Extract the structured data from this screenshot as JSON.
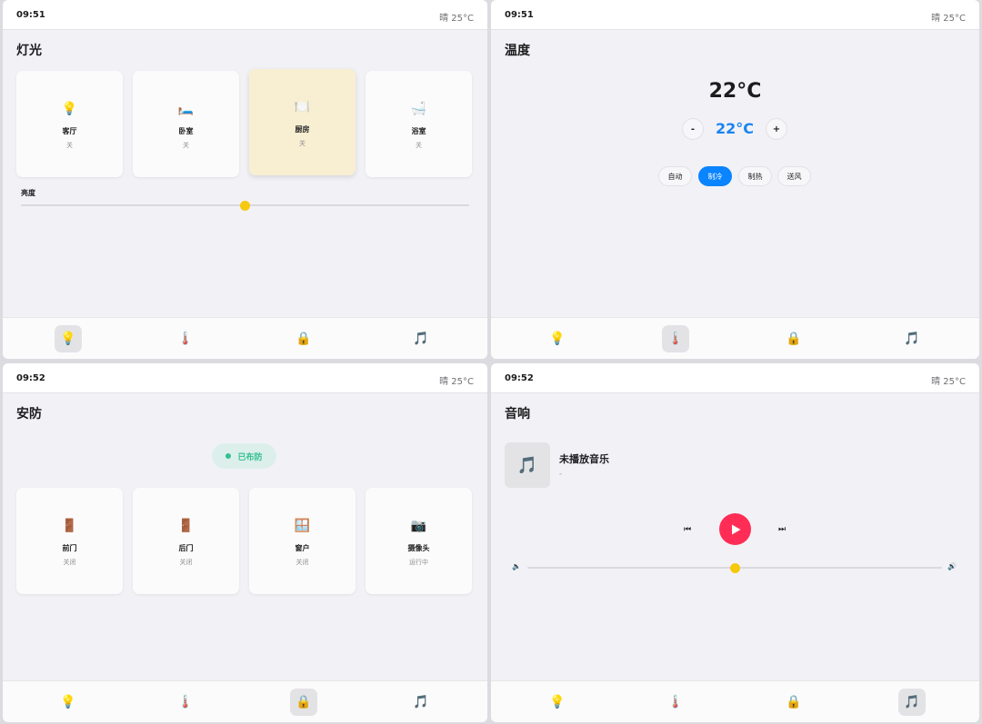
{
  "status": {
    "time_top": "09:51",
    "time_bottom": "09:52",
    "weather": "晴 25°C"
  },
  "tabs": {
    "light_icon": "💡",
    "temp_icon": "🌡️",
    "security_icon": "🔒",
    "music_icon": "🎵"
  },
  "lights": {
    "title": "灯光",
    "rooms": [
      {
        "icon": "💡",
        "name": "客厅",
        "state": "关"
      },
      {
        "icon": "🛏️",
        "name": "卧室",
        "state": "关"
      },
      {
        "icon": "🍽️",
        "name": "厨房",
        "state": "关"
      },
      {
        "icon": "🛁",
        "name": "浴室",
        "state": "关"
      }
    ],
    "brightness_label": "亮度",
    "brightness_value": 0.5
  },
  "temperature": {
    "title": "温度",
    "current": "22°C",
    "setpoint": "22°C",
    "minus": "-",
    "plus": "+",
    "modes": [
      "自动",
      "制冷",
      "制热",
      "送风"
    ],
    "selected_mode": "制冷"
  },
  "security": {
    "title": "安防",
    "status": "已布防",
    "devices": [
      {
        "icon": "🚪",
        "name": "前门",
        "state": "关闭"
      },
      {
        "icon": "🚪",
        "name": "后门",
        "state": "关闭"
      },
      {
        "icon": "🪟",
        "name": "窗户",
        "state": "关闭"
      },
      {
        "icon": "📷",
        "name": "摄像头",
        "state": "运行中"
      }
    ]
  },
  "music": {
    "title": "音响",
    "cover_icon": "🎵",
    "song": "未播放音乐",
    "artist": "-",
    "prev": "⏮",
    "next": "⏭",
    "volume_low_icon": "🔈",
    "volume_high_icon": "🔊",
    "volume_value": 0.5
  },
  "colors": {
    "accent_blue": "#0a84ff",
    "play_red": "#ff2d55",
    "slider_yellow": "#f6c90e",
    "armed_green": "#34c08f",
    "active_light_card": "#f8efd2"
  }
}
